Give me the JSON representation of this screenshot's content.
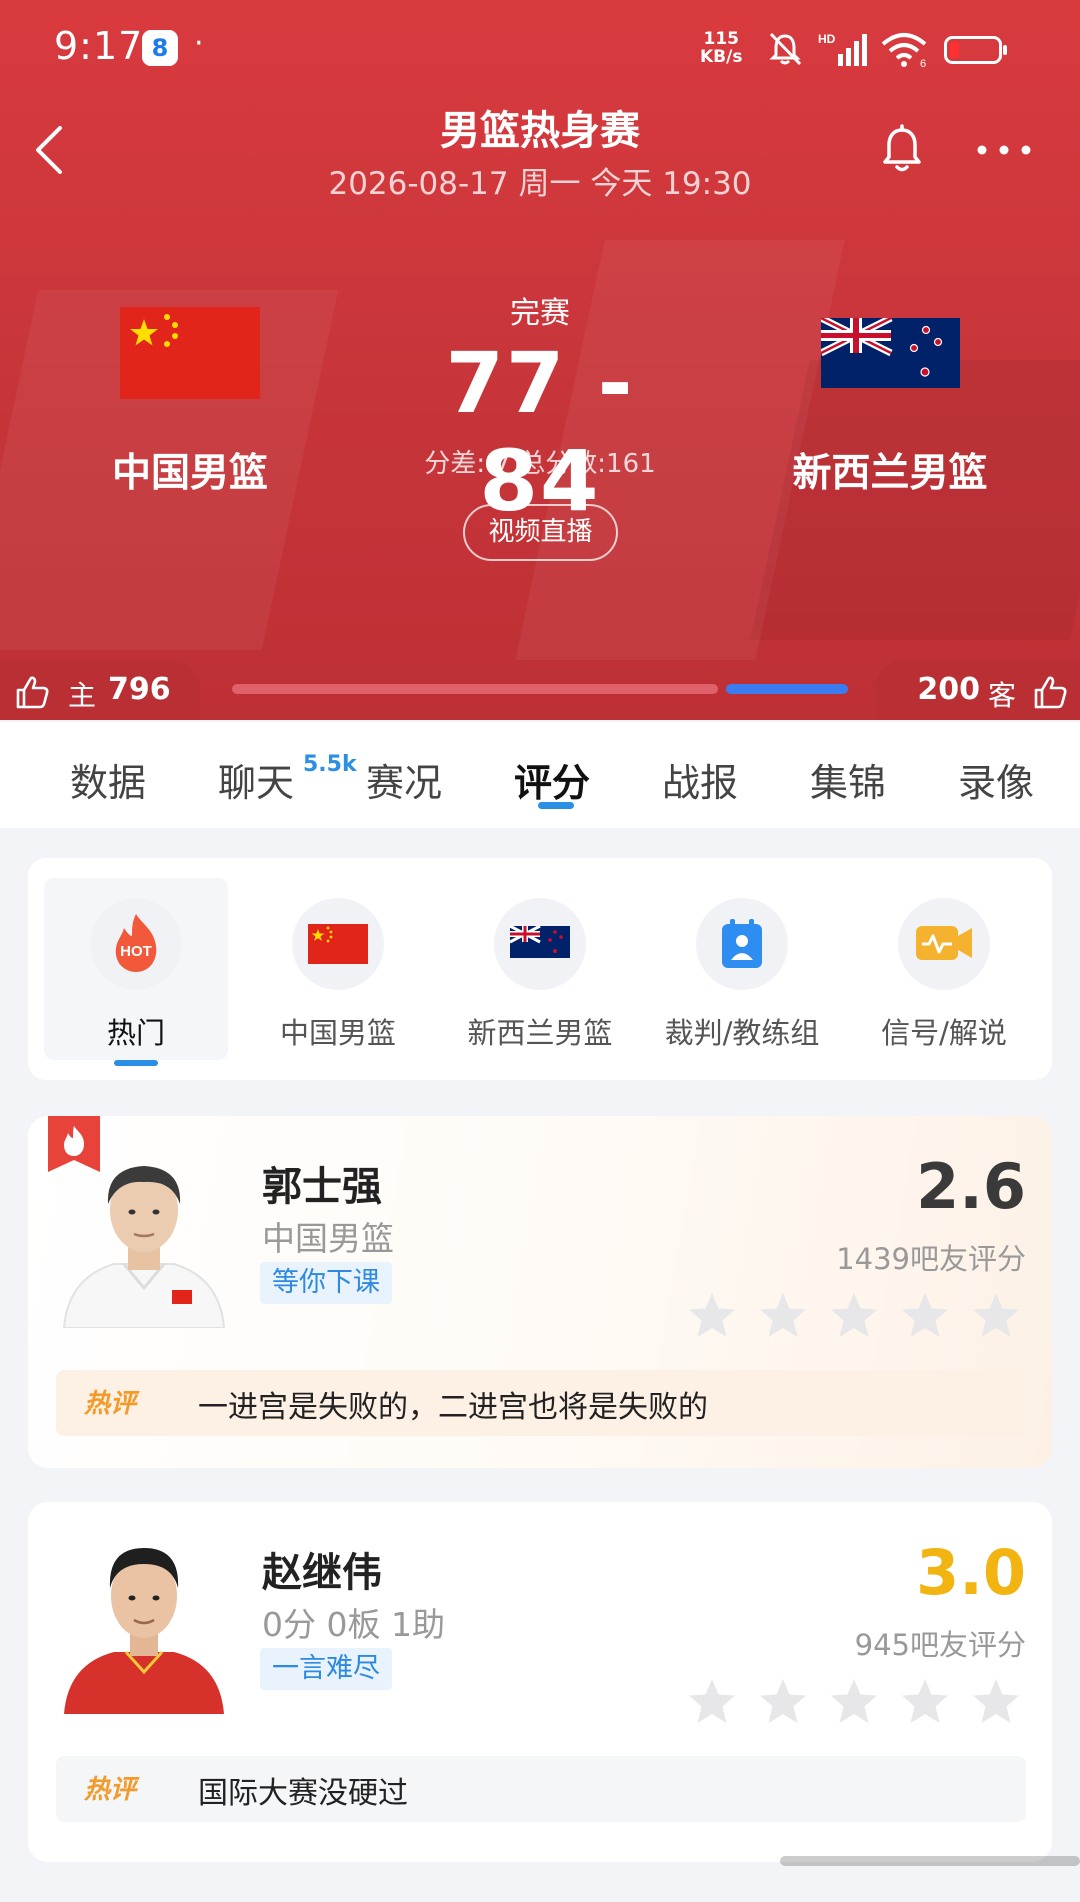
{
  "status_bar": {
    "time": "9:17",
    "app_badge": "8",
    "dot": "·",
    "speed_value": "115",
    "speed_unit": "KB/s",
    "wifi_label": "6"
  },
  "nav": {
    "title": "男篮热身赛",
    "subtitle": "2026-08-17 周一 今天 19:30"
  },
  "match": {
    "status": "完赛",
    "score": "77 - 84",
    "meta": "分差:-7 总分数:161",
    "video_button": "视频直播",
    "home_team": "中国男篮",
    "away_team": "新西兰男篮"
  },
  "votes": {
    "home_label": "主",
    "home_count": "796",
    "away_count": "200",
    "away_label": "客",
    "home_share": 0.8
  },
  "tabs": {
    "items": [
      "数据",
      "聊天",
      "赛况",
      "评分",
      "战报",
      "集锦",
      "录像"
    ],
    "chat_badge": "5.5k",
    "active": "评分"
  },
  "filters": {
    "hot_icon_text": "HOT",
    "items": [
      "热门",
      "中国男篮",
      "新西兰男篮",
      "裁判/教练组",
      "信号/解说"
    ],
    "active": "热门"
  },
  "players": [
    {
      "name": "郭士强",
      "subtitle": "中国男篮",
      "tag": "等你下课",
      "score": "2.6",
      "score_color": "#3a3a3a",
      "rating_count": "1439吧友评分",
      "comment_badge": "热评",
      "comment": "一进宫是失败的，二进宫也将是失败的",
      "hot": true
    },
    {
      "name": "赵继伟",
      "subtitle": "0分 0板 1助",
      "tag": "一言难尽",
      "score": "3.0",
      "score_color": "#f1b410",
      "rating_count": "945吧友评分",
      "comment_badge": "热评",
      "comment": "国际大赛没硬过",
      "hot": false
    }
  ],
  "colors": {
    "header_red": "#d93a3e",
    "accent_blue": "#2b8fe5",
    "hot_orange": "#f39a2a"
  }
}
